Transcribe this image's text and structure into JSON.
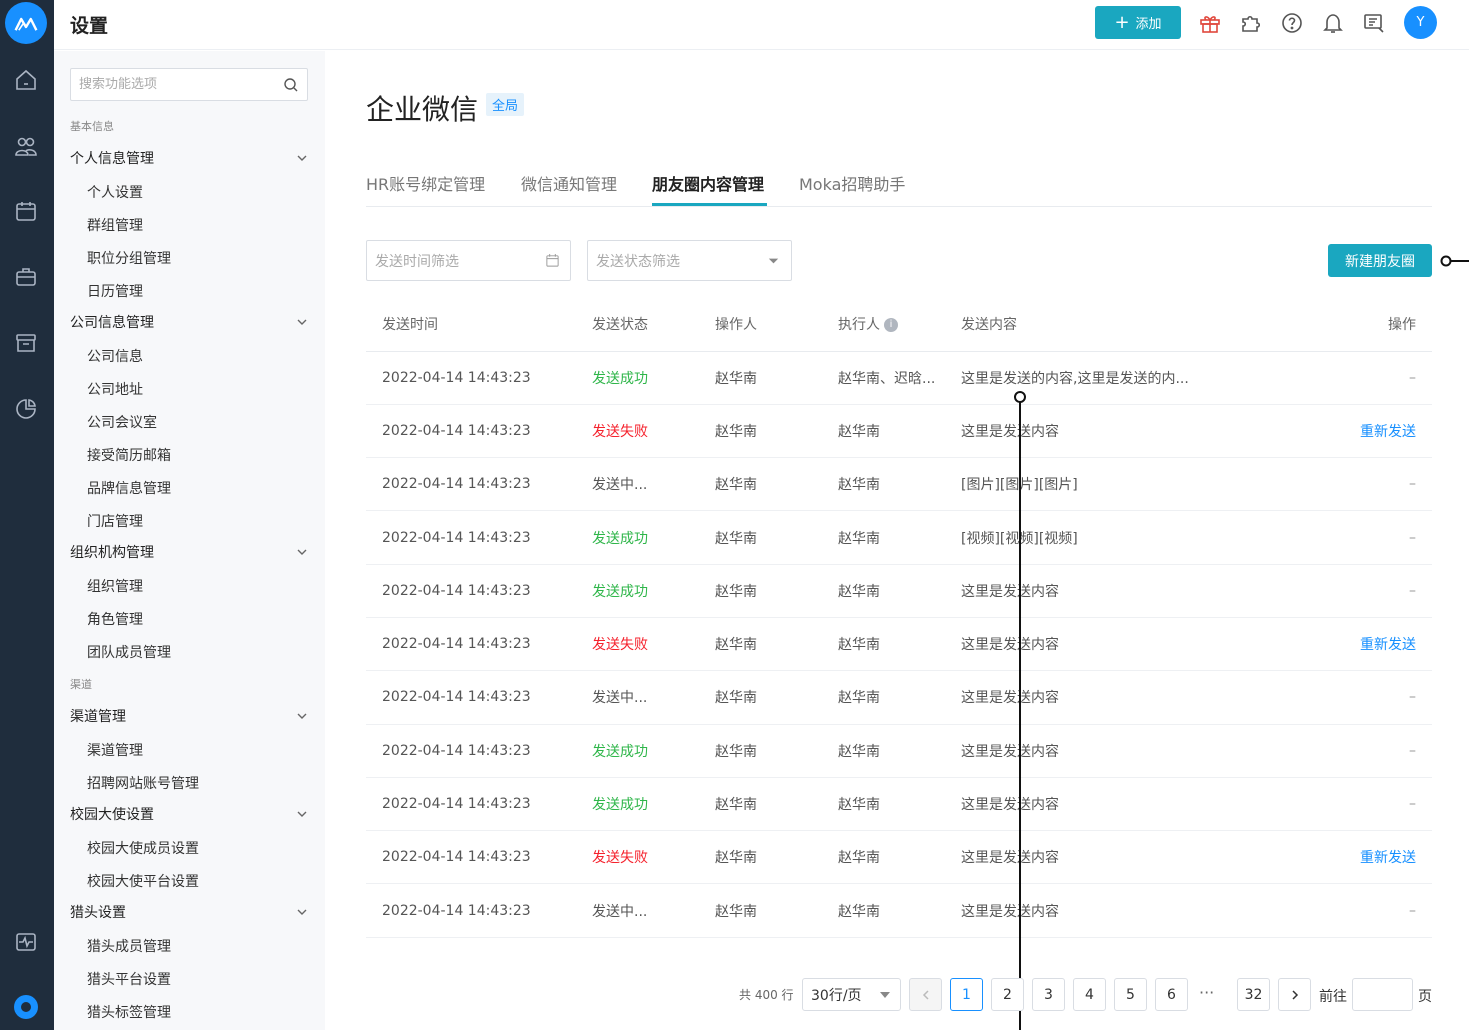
{
  "colors": {
    "accent": "#1aa7c0",
    "brand": "#1890ff",
    "success": "#2fb64a",
    "danger": "#f5222d",
    "rail": "#1f2d3d"
  },
  "rail": {
    "icons": [
      "home-icon",
      "users-icon",
      "calendar-icon",
      "briefcase-icon",
      "archive-icon",
      "chart-pie-icon",
      "activity-icon",
      "settings-icon"
    ]
  },
  "topbar": {
    "title": "设置",
    "add_label": "添加",
    "avatar_initial": "Y"
  },
  "sidebar": {
    "search_placeholder": "搜索功能选项",
    "group_basic": "基本信息",
    "group_channel": "渠道",
    "sections": [
      {
        "label": "个人信息管理",
        "items": [
          "个人设置",
          "群组管理",
          "职位分组管理",
          "日历管理"
        ]
      },
      {
        "label": "公司信息管理",
        "items": [
          "公司信息",
          "公司地址",
          "公司会议室",
          "接受简历邮箱",
          "品牌信息管理",
          "门店管理"
        ]
      },
      {
        "label": "组织机构管理",
        "items": [
          "组织管理",
          "角色管理",
          "团队成员管理"
        ]
      },
      {
        "label": "渠道管理",
        "items": [
          "渠道管理",
          "招聘网站账号管理"
        ]
      },
      {
        "label": "校园大使设置",
        "items": [
          "校园大使成员设置",
          "校园大使平台设置"
        ]
      },
      {
        "label": "猎头设置",
        "items": [
          "猎头成员管理",
          "猎头平台设置",
          "猎头标签管理"
        ]
      }
    ]
  },
  "page": {
    "title": "企业微信",
    "scope_tag": "全局",
    "tabs": [
      "HR账号绑定管理",
      "微信通知管理",
      "朋友圈内容管理",
      "Moka招聘助手"
    ],
    "active_tab": 2,
    "filter_time_placeholder": "发送时间筛选",
    "filter_status_placeholder": "发送状态筛选",
    "new_button": "新建朋友圈"
  },
  "table": {
    "columns": [
      "发送时间",
      "发送状态",
      "操作人",
      "执行人",
      "发送内容",
      "操作"
    ],
    "info_icon": "i",
    "rows": [
      {
        "time": "2022-04-14  14:43:23",
        "status": "发送成功",
        "status_type": "ok",
        "operator": "赵华南",
        "executor": "赵华南、迟晗...",
        "content": "这里是发送的内容,这里是发送的内...",
        "action": "–"
      },
      {
        "time": "2022-04-14  14:43:23",
        "status": "发送失败",
        "status_type": "fail",
        "operator": "赵华南",
        "executor": "赵华南",
        "content": "这里是发送内容",
        "action": "重新发送"
      },
      {
        "time": "2022-04-14  14:43:23",
        "status": "发送中...",
        "status_type": "pend",
        "operator": "赵华南",
        "executor": "赵华南",
        "content": "[图片][图片][图片]",
        "action": "–"
      },
      {
        "time": "2022-04-14  14:43:23",
        "status": "发送成功",
        "status_type": "ok",
        "operator": "赵华南",
        "executor": "赵华南",
        "content": "[视频][视频][视频]",
        "action": "–"
      },
      {
        "time": "2022-04-14  14:43:23",
        "status": "发送成功",
        "status_type": "ok",
        "operator": "赵华南",
        "executor": "赵华南",
        "content": "这里是发送内容",
        "action": "–"
      },
      {
        "time": "2022-04-14  14:43:23",
        "status": "发送失败",
        "status_type": "fail",
        "operator": "赵华南",
        "executor": "赵华南",
        "content": "这里是发送内容",
        "action": "重新发送"
      },
      {
        "time": "2022-04-14  14:43:23",
        "status": "发送中...",
        "status_type": "pend",
        "operator": "赵华南",
        "executor": "赵华南",
        "content": "这里是发送内容",
        "action": "–"
      },
      {
        "time": "2022-04-14  14:43:23",
        "status": "发送成功",
        "status_type": "ok",
        "operator": "赵华南",
        "executor": "赵华南",
        "content": "这里是发送内容",
        "action": "–"
      },
      {
        "time": "2022-04-14  14:43:23",
        "status": "发送成功",
        "status_type": "ok",
        "operator": "赵华南",
        "executor": "赵华南",
        "content": "这里是发送内容",
        "action": "–"
      },
      {
        "time": "2022-04-14  14:43:23",
        "status": "发送失败",
        "status_type": "fail",
        "operator": "赵华南",
        "executor": "赵华南",
        "content": "这里是发送内容",
        "action": "重新发送"
      },
      {
        "time": "2022-04-14  14:43:23",
        "status": "发送中...",
        "status_type": "pend",
        "operator": "赵华南",
        "executor": "赵华南",
        "content": "这里是发送内容",
        "action": "–"
      }
    ]
  },
  "pagination": {
    "total_text": "共 400 行",
    "page_size": "30行/页",
    "pages": [
      "1",
      "2",
      "3",
      "4",
      "5",
      "6"
    ],
    "ellipsis": "···",
    "last_page": "32",
    "current": "1",
    "goto_label": "前往",
    "page_suffix": "页"
  }
}
